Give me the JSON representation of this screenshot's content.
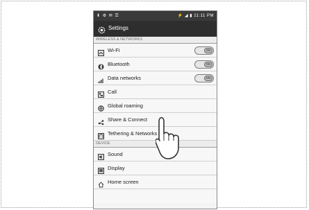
{
  "status_bar": {
    "left_icons": "⬇ ⚙ ✉ ☰",
    "right_text": "⚡ ◢ ▮ 11:11 PM"
  },
  "header": {
    "title": "Settings"
  },
  "sections": {
    "wireless": {
      "label": "WIRELESS & NETWORKS"
    },
    "device": {
      "label": "DEVICE"
    }
  },
  "rows": {
    "wifi": {
      "label": "Wi-Fi",
      "toggle": "ON"
    },
    "bluetooth": {
      "label": "Bluetooth",
      "toggle": "ON"
    },
    "data_networks": {
      "label": "Data networks",
      "toggle": "ON"
    },
    "call": {
      "label": "Call"
    },
    "global_roaming": {
      "label": "Global roaming"
    },
    "share_connect": {
      "label": "Share & Connect"
    },
    "tethering": {
      "label": "Tethering & Networks"
    },
    "sound": {
      "label": "Sound"
    },
    "display": {
      "label": "Display"
    },
    "home_screen": {
      "label": "Home screen"
    }
  },
  "icons": [
    "gear-icon",
    "wifi-icon",
    "bluetooth-icon",
    "data-network-icon",
    "call-icon",
    "globe-icon",
    "share-icon",
    "tethering-icon",
    "sound-icon",
    "display-icon",
    "home-icon",
    "pointing-hand-icon"
  ]
}
